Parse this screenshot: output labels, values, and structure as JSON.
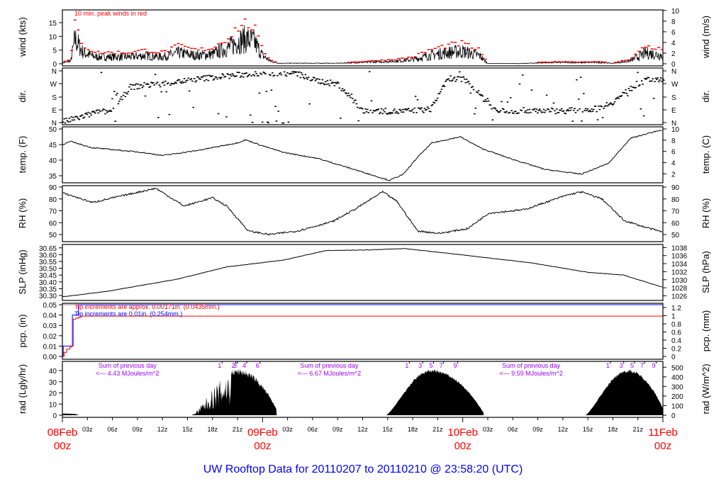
{
  "chart_data": {
    "type": "line",
    "title": "UW Rooftop Data for 20110207  to  20110210 @ 23:58:20  (UTC)",
    "x_unit": "hours since 08Feb 00z",
    "xlim": [
      0,
      72
    ],
    "x_major_labels": [
      {
        "h": 0,
        "day": "08Feb",
        "hour": "00z"
      },
      {
        "h": 24,
        "day": "09Feb",
        "hour": "00z"
      },
      {
        "h": 48,
        "day": "10Feb",
        "hour": "00z"
      },
      {
        "h": 72,
        "day": "11Feb",
        "hour": "00z"
      }
    ],
    "x_minor_labels": [
      "03z",
      "06z",
      "09z",
      "12z",
      "15z",
      "18z",
      "21z"
    ],
    "panels": {
      "wind": {
        "ylabel": "wind (kts)",
        "ylabel_right": "wind (m/s)",
        "yticks": [
          0,
          5,
          10,
          15
        ],
        "yticks_right": [
          0,
          2,
          4,
          6,
          8,
          10
        ],
        "annotation": "10 min. peak winds in red",
        "envelope_hours": [
          0,
          1,
          1.5,
          2.5,
          4,
          6,
          8,
          10,
          12,
          14,
          16,
          18,
          20,
          21,
          22,
          23,
          24,
          25,
          26,
          30,
          33,
          36,
          40,
          42,
          44,
          46,
          48,
          50,
          51,
          53,
          55,
          57,
          60,
          62,
          64,
          66,
          68,
          70,
          72
        ],
        "envelope_kts": [
          0.3,
          1,
          9,
          4,
          2.5,
          2.5,
          2.5,
          3,
          2.5,
          4,
          3,
          3.5,
          6,
          8,
          9,
          8,
          3,
          0.8,
          0.2,
          0.2,
          0.2,
          0.5,
          1,
          1.5,
          3,
          4,
          4.5,
          3,
          0.1,
          0.1,
          0.1,
          0.3,
          0.5,
          0.4,
          0.5,
          0.2,
          1,
          4,
          3
        ]
      },
      "direction": {
        "ylabel": "dir.",
        "yticks": [
          "N",
          "E",
          "S",
          "W",
          "N"
        ],
        "trend_hours": [
          0,
          2,
          4,
          6,
          8,
          10,
          12,
          14,
          18,
          22,
          24,
          28,
          30,
          33,
          36,
          38,
          40,
          44,
          46,
          48,
          52,
          56,
          60,
          64,
          66,
          68,
          70,
          72
        ],
        "trend_degrees": [
          10,
          40,
          75,
          85,
          250,
          265,
          275,
          290,
          320,
          340,
          350,
          345,
          300,
          270,
          80,
          85,
          80,
          95,
          300,
          310,
          80,
          90,
          85,
          100,
          150,
          240,
          300,
          310
        ]
      },
      "temperature": {
        "ylabel": "temp. (F)",
        "ylabel_right": "temp. (C)",
        "yticks": [
          35,
          40,
          45,
          50
        ],
        "yticks_right": [
          2,
          4,
          6,
          8,
          10
        ],
        "series": [
          [
            0,
            45
          ],
          [
            1,
            46
          ],
          [
            3.5,
            44
          ],
          [
            9.5,
            42.5
          ],
          [
            12,
            41.5
          ],
          [
            16,
            43
          ],
          [
            20.9,
            45.5
          ],
          [
            22,
            46.5
          ],
          [
            24.1,
            44.5
          ],
          [
            26.5,
            42.5
          ],
          [
            30.7,
            40.5
          ],
          [
            35,
            37
          ],
          [
            39.2,
            33.5
          ],
          [
            40.9,
            35.5
          ],
          [
            42.6,
            41
          ],
          [
            44.3,
            45.5
          ],
          [
            47.7,
            47.5
          ],
          [
            50.3,
            43.7
          ],
          [
            53.7,
            40.5
          ],
          [
            57.9,
            37
          ],
          [
            62.2,
            35.5
          ],
          [
            65.5,
            39
          ],
          [
            68.1,
            47
          ],
          [
            71.5,
            49.5
          ],
          [
            72,
            49.5
          ]
        ]
      },
      "rh": {
        "ylabel": "RH (%)",
        "ylabel_right": "RH (%)",
        "yticks": [
          50,
          60,
          70,
          80,
          90
        ],
        "yticks_right": [
          50,
          60,
          70,
          80,
          90
        ],
        "series": [
          [
            0,
            85
          ],
          [
            1,
            83
          ],
          [
            3.6,
            77
          ],
          [
            6.1,
            81
          ],
          [
            11.2,
            89
          ],
          [
            14.6,
            74
          ],
          [
            18,
            81
          ],
          [
            19.7,
            74
          ],
          [
            22.3,
            53
          ],
          [
            24.8,
            50
          ],
          [
            28.2,
            53
          ],
          [
            32.4,
            61
          ],
          [
            35,
            71
          ],
          [
            38.4,
            86
          ],
          [
            40.1,
            78
          ],
          [
            42.6,
            53
          ],
          [
            45.2,
            51
          ],
          [
            48.6,
            55
          ],
          [
            51.1,
            68
          ],
          [
            55.4,
            71
          ],
          [
            60.4,
            83
          ],
          [
            62.2,
            86
          ],
          [
            64.7,
            80
          ],
          [
            67.3,
            62
          ],
          [
            69,
            58
          ],
          [
            72,
            52
          ]
        ]
      },
      "pressure": {
        "ylabel": "SLP (inHg)",
        "ylabel_right": "SLP (hPa)",
        "yticks": [
          30.3,
          30.35,
          30.4,
          30.45,
          30.5,
          30.55,
          30.6,
          30.65
        ],
        "yticks_right": [
          1026,
          1028,
          1030,
          1032,
          1034,
          1036,
          1038
        ],
        "series": [
          [
            0,
            30.29
          ],
          [
            5.3,
            30.33
          ],
          [
            13.8,
            30.42
          ],
          [
            19.7,
            30.51
          ],
          [
            26.5,
            30.56
          ],
          [
            31.6,
            30.63
          ],
          [
            36.7,
            30.635
          ],
          [
            41,
            30.645
          ],
          [
            47.7,
            30.6
          ],
          [
            56.2,
            30.54
          ],
          [
            63,
            30.47
          ],
          [
            67.3,
            30.45
          ],
          [
            72,
            30.36
          ]
        ]
      },
      "precipitation": {
        "ylabel": "pcp. (in)",
        "ylabel_right": "pcp. (mm)",
        "yticks": [
          0.0,
          0.01,
          0.02,
          0.03,
          0.04,
          0.05
        ],
        "yticks_right": [
          0,
          0.2,
          0.4,
          0.6,
          0.8,
          1,
          1.2
        ],
        "legend": [
          {
            "label": "Tip increments are approx. 0.00171in. (0.0435mm.)",
            "color": "#ff0000"
          },
          {
            "label": "Tip increments are 0.01in. (0.254mm.)",
            "color": "#0000ff"
          }
        ],
        "red_series": [
          [
            0,
            0
          ],
          [
            0.2,
            0.004
          ],
          [
            0.5,
            0.007
          ],
          [
            0.9,
            0.009
          ],
          [
            1.1,
            0.01
          ],
          [
            1.3,
            0.036
          ],
          [
            1.6,
            0.037
          ],
          [
            1.9,
            0.038
          ],
          [
            2.3,
            0.039
          ],
          [
            72,
            0.039
          ]
        ],
        "blue_series": [
          [
            0,
            0
          ],
          [
            0.1,
            0.01
          ],
          [
            1.1,
            0.01
          ],
          [
            1.2,
            0.04
          ],
          [
            1.8,
            0.04
          ],
          [
            1.9,
            0.05
          ],
          [
            72,
            0.05
          ]
        ]
      },
      "radiation": {
        "ylabel": "rad (Lgly/hr)",
        "ylabel_right": "rad (W/m^2)",
        "yticks": [
          0,
          10,
          20,
          30,
          40
        ],
        "yticks_right": [
          0,
          100,
          200,
          300,
          400,
          500
        ],
        "daily_sums": [
          {
            "h": 7.8,
            "line1": "Sum of previous day",
            "line2": "<--- 4.43 MJoules/m^2"
          },
          {
            "h": 32,
            "line1": "Sum of previous day",
            "line2": "<--- 6.67 MJoules/m^2"
          },
          {
            "h": 56.2,
            "line1": "Sum of previous day",
            "line2": "<--- 9.59 MJoules/m^2"
          }
        ],
        "hour_marks": [
          {
            "h": 18.85,
            "label": "1"
          },
          {
            "h": 20.5,
            "label": "2"
          },
          {
            "h": 20.7,
            "label": "3"
          },
          {
            "h": 21.8,
            "label": "4"
          },
          {
            "h": 23.4,
            "label": "6"
          },
          {
            "h": 41.3,
            "label": "1"
          },
          {
            "h": 42.9,
            "label": "3"
          },
          {
            "h": 44.2,
            "label": "5"
          },
          {
            "h": 45.4,
            "label": "7"
          },
          {
            "h": 47.1,
            "label": "9"
          },
          {
            "h": 65.4,
            "label": "1"
          },
          {
            "h": 67.0,
            "label": "3"
          },
          {
            "h": 68.3,
            "label": "5"
          },
          {
            "h": 69.5,
            "label": "7"
          },
          {
            "h": 70.9,
            "label": "9"
          }
        ],
        "days": [
          {
            "start": 15.5,
            "peak": 21,
            "end": 25.7,
            "max": 42,
            "spiky": true
          },
          {
            "start": 38.8,
            "peak": 44.2,
            "end": 50.5,
            "max": 41,
            "spiky": false
          },
          {
            "start": 62.7,
            "peak": 67.8,
            "end": 72,
            "max": 41,
            "spiky": false
          }
        ],
        "night_start": [
          [
            0,
            1.5
          ],
          [
            1.5,
            1.2
          ],
          [
            2,
            0
          ]
        ]
      }
    },
    "colors": {
      "title": "#0000ff",
      "day_labels": "#ff0000",
      "peaks": "#ff0000",
      "radiation_text": "#9900ff"
    }
  }
}
